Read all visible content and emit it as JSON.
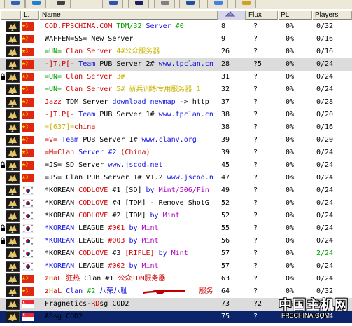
{
  "toolbar": {
    "buttons": [
      "refresh-icon",
      "globe-icon",
      "search-icon",
      "tools-icon",
      "card-icon",
      "mail-icon",
      "monitor-icon",
      "down-arrow-icon",
      "triangle-icon"
    ]
  },
  "columns": {
    "lock": "",
    "loc": "L.",
    "name": "Name",
    "ping": "",
    "flux": "Flux",
    "pl": "PL",
    "players": "Players"
  },
  "rows": [
    {
      "lock": false,
      "flag": "cn",
      "segs": [
        {
          "t": "COD.FPSCHINA.COM ",
          "c": "red"
        },
        {
          "t": "TDM/32 ",
          "c": "grn"
        },
        {
          "t": "Server ",
          "c": "blu"
        },
        {
          "t": "#0",
          "c": "grn"
        }
      ],
      "ping": "8",
      "flux": "?",
      "pl": "0%",
      "players": "0/32",
      "style": ""
    },
    {
      "lock": false,
      "flag": "cn",
      "segs": [
        {
          "t": "WAFFEN=SS= New Server",
          "c": "blk"
        }
      ],
      "ping": "9",
      "flux": "?",
      "pl": "0%",
      "players": "0/16",
      "style": ""
    },
    {
      "lock": false,
      "flag": "cn",
      "segs": [
        {
          "t": "=UN= ",
          "c": "grn"
        },
        {
          "t": "Clan Server ",
          "c": "red"
        },
        {
          "t": "4#公众服务器",
          "c": "yel"
        }
      ],
      "ping": "26",
      "flux": "?",
      "pl": "0%",
      "players": "0/16",
      "style": ""
    },
    {
      "lock": false,
      "flag": "cn",
      "segs": [
        {
          "t": "-]T.P[- ",
          "c": "red"
        },
        {
          "t": "Team ",
          "c": "blu"
        },
        {
          "t": "PUB Server 2# ",
          "c": "blk"
        },
        {
          "t": "www.tpclan.cn",
          "c": "blu"
        }
      ],
      "ping": "28",
      "flux": "?5",
      "pl": "0%",
      "players": "0/24",
      "style": "hl"
    },
    {
      "lock": true,
      "flag": "cn",
      "segs": [
        {
          "t": "=UN= ",
          "c": "grn"
        },
        {
          "t": "Clan Server ",
          "c": "red"
        },
        {
          "t": "3#",
          "c": "yel"
        }
      ],
      "ping": "31",
      "flux": "?",
      "pl": "0%",
      "players": "0/24",
      "style": ""
    },
    {
      "lock": false,
      "flag": "cn",
      "segs": [
        {
          "t": "=UN= ",
          "c": "grn"
        },
        {
          "t": "Clan Server ",
          "c": "red"
        },
        {
          "t": "5# 新兵训练专用服务器 1",
          "c": "yel"
        }
      ],
      "ping": "32",
      "flux": "?",
      "pl": "0%",
      "players": "0/24",
      "style": ""
    },
    {
      "lock": false,
      "flag": "cn",
      "segs": [
        {
          "t": "Jazz ",
          "c": "red"
        },
        {
          "t": "TDM Server ",
          "c": "blk"
        },
        {
          "t": "download newmap ",
          "c": "blu"
        },
        {
          "t": "-> http",
          "c": "blk"
        }
      ],
      "ping": "37",
      "flux": "?",
      "pl": "0%",
      "players": "0/28",
      "style": ""
    },
    {
      "lock": false,
      "flag": "cn",
      "segs": [
        {
          "t": "-]T.P[- ",
          "c": "red"
        },
        {
          "t": "Team ",
          "c": "blu"
        },
        {
          "t": "PUB Server 1# ",
          "c": "blk"
        },
        {
          "t": "www.tpclan.cn",
          "c": "blu"
        }
      ],
      "ping": "38",
      "flux": "?",
      "pl": "0%",
      "players": "0/20",
      "style": ""
    },
    {
      "lock": false,
      "flag": "cn",
      "segs": [
        {
          "t": "=[637]=",
          "c": "yel"
        },
        {
          "t": "china",
          "c": "red"
        }
      ],
      "ping": "38",
      "flux": "?",
      "pl": "0%",
      "players": "0/16",
      "style": ""
    },
    {
      "lock": false,
      "flag": "cn",
      "segs": [
        {
          "t": "=V= ",
          "c": "red"
        },
        {
          "t": "Team ",
          "c": "blu"
        },
        {
          "t": "PUB Server 1# ",
          "c": "blk"
        },
        {
          "t": "www.clanv.org",
          "c": "blu"
        }
      ],
      "ping": "39",
      "flux": "?",
      "pl": "0%",
      "players": "0/20",
      "style": ""
    },
    {
      "lock": false,
      "flag": "cn",
      "segs": [
        {
          "t": "=M=Clan ",
          "c": "red"
        },
        {
          "t": "Server #2 ",
          "c": "blu"
        },
        {
          "t": "(China)",
          "c": "red"
        }
      ],
      "ping": "39",
      "flux": "?",
      "pl": "0%",
      "players": "0/24",
      "style": ""
    },
    {
      "lock": true,
      "flag": "cn",
      "segs": [
        {
          "t": "=JS= SD Server ",
          "c": "blk"
        },
        {
          "t": "www.jscod.net",
          "c": "blu"
        }
      ],
      "ping": "45",
      "flux": "?",
      "pl": "0%",
      "players": "0/24",
      "style": ""
    },
    {
      "lock": false,
      "flag": "cn",
      "segs": [
        {
          "t": "=JS= Clan PUB Server 1# V1.2 ",
          "c": "blk"
        },
        {
          "t": "www.jscod.n",
          "c": "blu"
        }
      ],
      "ping": "47",
      "flux": "?",
      "pl": "0%",
      "players": "0/24",
      "style": ""
    },
    {
      "lock": false,
      "flag": "kr",
      "segs": [
        {
          "t": "*KOREAN ",
          "c": "blk"
        },
        {
          "t": "CODLOVE ",
          "c": "red"
        },
        {
          "t": "#1 [SD] ",
          "c": "blk"
        },
        {
          "t": "by ",
          "c": "blu"
        },
        {
          "t": "Mint/506/Fin",
          "c": "purple"
        }
      ],
      "ping": "49",
      "flux": "?",
      "pl": "0%",
      "players": "0/24",
      "style": ""
    },
    {
      "lock": false,
      "flag": "kr",
      "segs": [
        {
          "t": "*KOREAN ",
          "c": "blk"
        },
        {
          "t": "CODLOVE ",
          "c": "red"
        },
        {
          "t": "#4 [TDM] ",
          "c": "blk"
        },
        {
          "t": "- Remove ShotG",
          "c": "blk"
        }
      ],
      "ping": "52",
      "flux": "?",
      "pl": "0%",
      "players": "0/24",
      "style": ""
    },
    {
      "lock": false,
      "flag": "kr",
      "segs": [
        {
          "t": "*KOREAN ",
          "c": "blk"
        },
        {
          "t": "CODLOVE ",
          "c": "red"
        },
        {
          "t": "#2 [TDM] ",
          "c": "blk"
        },
        {
          "t": "by ",
          "c": "blu"
        },
        {
          "t": "Mint",
          "c": "purple"
        }
      ],
      "ping": "52",
      "flux": "?",
      "pl": "0%",
      "players": "0/24",
      "style": ""
    },
    {
      "lock": true,
      "flag": "kr",
      "segs": [
        {
          "t": "*KOREAN ",
          "c": "blu"
        },
        {
          "t": "LEAGUE ",
          "c": "blk"
        },
        {
          "t": "#001 ",
          "c": "red"
        },
        {
          "t": "by ",
          "c": "blu"
        },
        {
          "t": "Mint",
          "c": "purple"
        }
      ],
      "ping": "55",
      "flux": "?",
      "pl": "0%",
      "players": "0/24",
      "style": ""
    },
    {
      "lock": true,
      "flag": "kr",
      "segs": [
        {
          "t": "*KOREAN ",
          "c": "blu"
        },
        {
          "t": "LEAGUE ",
          "c": "blk"
        },
        {
          "t": "#003 ",
          "c": "red"
        },
        {
          "t": "by ",
          "c": "blu"
        },
        {
          "t": "Mint",
          "c": "purple"
        }
      ],
      "ping": "56",
      "flux": "?",
      "pl": "0%",
      "players": "0/24",
      "style": ""
    },
    {
      "lock": false,
      "flag": "kr",
      "segs": [
        {
          "t": "*KOREAN ",
          "c": "blk"
        },
        {
          "t": "CODLOVE ",
          "c": "red"
        },
        {
          "t": "#3 ",
          "c": "blk"
        },
        {
          "t": "[RIFLE] ",
          "c": "red"
        },
        {
          "t": "by ",
          "c": "blu"
        },
        {
          "t": "Mint",
          "c": "purple"
        }
      ],
      "ping": "57",
      "flux": "?",
      "pl": "0%",
      "players": "2/24",
      "style": ""
    },
    {
      "lock": false,
      "flag": "kr",
      "segs": [
        {
          "t": "*KOREAN ",
          "c": "blu"
        },
        {
          "t": "LEAGUE ",
          "c": "blk"
        },
        {
          "t": "#002 ",
          "c": "red"
        },
        {
          "t": "by ",
          "c": "blu"
        },
        {
          "t": "Mint",
          "c": "purple"
        }
      ],
      "ping": "57",
      "flux": "?",
      "pl": "0%",
      "players": "0/24",
      "style": ""
    },
    {
      "lock": false,
      "flag": "cn",
      "segs": [
        {
          "t": "z",
          "c": "red"
        },
        {
          "t": "H",
          "c": "yel"
        },
        {
          "t": "aL ",
          "c": "red"
        },
        {
          "t": "狂热 ",
          "c": "red"
        },
        {
          "t": "Clan #1 ",
          "c": "blk"
        },
        {
          "t": "公众TDM服务器",
          "c": "red"
        }
      ],
      "ping": "63",
      "flux": "?",
      "pl": "0%",
      "players": "0/24",
      "style": ""
    },
    {
      "lock": false,
      "flag": "cn",
      "segs": [
        {
          "t": "z",
          "c": "red"
        },
        {
          "t": "H",
          "c": "yel"
        },
        {
          "t": "aL ",
          "c": "red"
        },
        {
          "t": "Clan ",
          "c": "blu"
        },
        {
          "t": "#2 ",
          "c": "grn"
        },
        {
          "t": "八荣八耻",
          "c": "blu"
        },
        {
          "t": "                 服务器",
          "c": "red"
        }
      ],
      "ping": "64",
      "flux": "?",
      "pl": "0%",
      "players": "0/32",
      "style": "",
      "gun": true
    },
    {
      "lock": false,
      "flag": "sg",
      "segs": [
        {
          "t": "Fragnetics-",
          "c": "blk"
        },
        {
          "t": "RD",
          "c": "red"
        },
        {
          "t": "sg COD2",
          "c": "blk"
        }
      ],
      "ping": "73",
      "flux": "?2",
      "pl": "0%",
      "players": "0/24",
      "style": "hl"
    },
    {
      "lock": false,
      "flag": "sg",
      "segs": [
        {
          "t": "ABsg COD2",
          "c": "blk"
        }
      ],
      "ping": "75",
      "flux": "?",
      "pl": "0%",
      "players": "0/24",
      "style": "sel"
    }
  ],
  "watermark": {
    "big": "中国主机网",
    "small": "FPSCHINA.COM"
  }
}
